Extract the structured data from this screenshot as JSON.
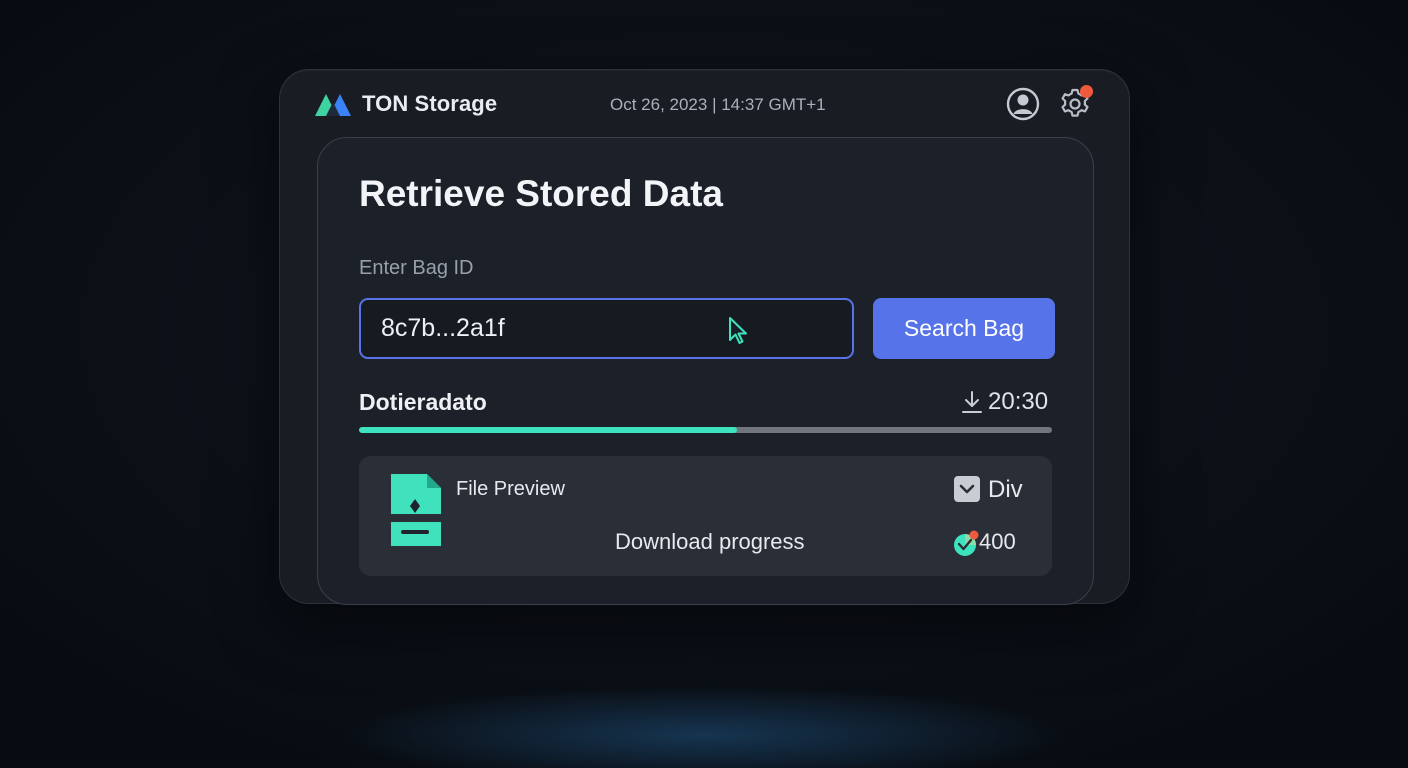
{
  "header": {
    "app_title": "TON Storage",
    "datetime": "Oct 26, 2023 | 14:37 GMT+1",
    "logo_icon": "ton-logo-icon",
    "profile_icon": "user-avatar-icon",
    "settings_icon": "gear-icon",
    "notification_color": "#f05a3c"
  },
  "retrieve": {
    "title": "Retrieve Stored Data",
    "field_label": "Enter Bag ID",
    "bag_id_value": "8c7b...2a1f",
    "search_button_label": "Search Bag",
    "accent_color": "#5673ea"
  },
  "download": {
    "name": "Dotieradato",
    "time": "20:30",
    "progress_fraction": 0.545,
    "progress_color": "#3de3be"
  },
  "preview": {
    "label": "File Preview",
    "progress_label": "Download progress",
    "checkbox_label": "Div",
    "count": "400",
    "file_icon": "file-document-icon"
  }
}
